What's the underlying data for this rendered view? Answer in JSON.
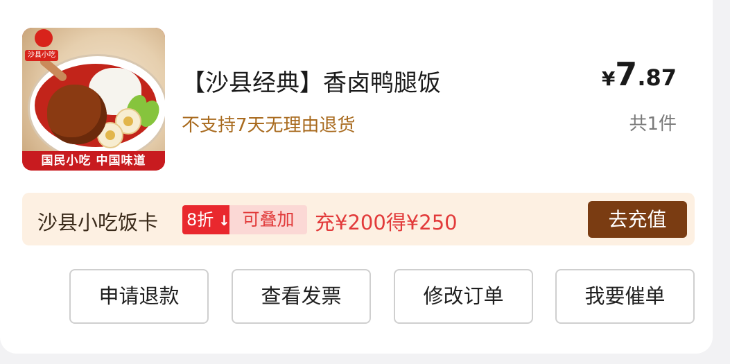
{
  "product": {
    "title": "【沙县经典】香卤鸭腿饭",
    "policy": "不支持7天无理由退货",
    "price_currency": "¥",
    "price_integer": "7",
    "price_decimal": ".87",
    "quantity": "共1件",
    "thumbnail": {
      "logo_text": "沙县小吃",
      "band_text": "国民小吃  中国味道"
    }
  },
  "promo": {
    "name": "沙县小吃饭卡",
    "discount": "8折",
    "discount_icon": "arrow-down-icon",
    "stackable": "可叠加",
    "offer": "充¥200得¥250",
    "button": "去充值"
  },
  "actions": [
    {
      "label": "申请退款"
    },
    {
      "label": "查看发票"
    },
    {
      "label": "修改订单"
    },
    {
      "label": "我要催单"
    }
  ],
  "colors": {
    "policy": "#a86a1e",
    "promo_bg": "#fdf0e2",
    "discount_red": "#e9282e",
    "recharge_button": "#7a3c12"
  }
}
